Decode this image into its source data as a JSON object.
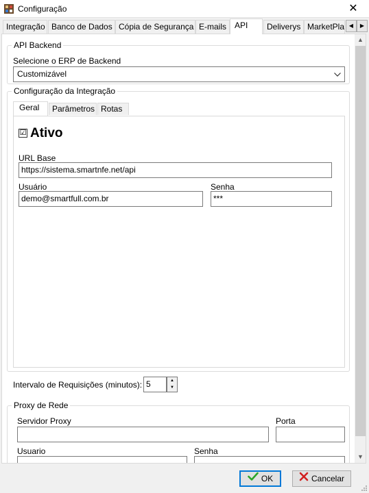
{
  "window": {
    "title": "Configuração",
    "close_glyph": "✕"
  },
  "tabs": [
    {
      "label": "Integração"
    },
    {
      "label": "Banco de Dados"
    },
    {
      "label": "Cópia de Segurança"
    },
    {
      "label": "E-mails"
    },
    {
      "label": "API"
    },
    {
      "label": "Deliverys"
    },
    {
      "label": "MarketPla"
    }
  ],
  "tab_scroll": {
    "left": "◀",
    "right": "▶"
  },
  "api_backend": {
    "group_label": "API Backend",
    "erp_label": "Selecione o ERP de Backend",
    "erp_value": "Customizável"
  },
  "integracao": {
    "group_label": "Configuração da Integração",
    "tabs": [
      {
        "label": "Geral"
      },
      {
        "label": "Parâmetros"
      },
      {
        "label": "Rotas"
      }
    ],
    "ativo_label": "Ativo",
    "ativo_checked": "☑",
    "url_label": "URL Base",
    "url_value": "https://sistema.smartnfe.net/api",
    "usuario_label": "Usuário",
    "usuario_value": "demo@smartfull.com.br",
    "senha_label": "Senha",
    "senha_value": "***"
  },
  "intervalo": {
    "label": "Intervalo de Requisições (minutos):",
    "value": "5"
  },
  "proxy": {
    "group_label": "Proxy de Rede",
    "servidor_label": "Servidor Proxy",
    "servidor_value": "",
    "porta_label": "Porta",
    "porta_value": "",
    "usuario_label": "Usuario",
    "usuario_value": "",
    "senha_label": "Senha",
    "senha_value": ""
  },
  "buttons": {
    "ok_label": "OK",
    "cancel_label": "Cancelar"
  },
  "colors": {
    "ok_check": "#2aa52a",
    "cancel_x": "#d11f1f",
    "focus_border": "#0078d7"
  }
}
